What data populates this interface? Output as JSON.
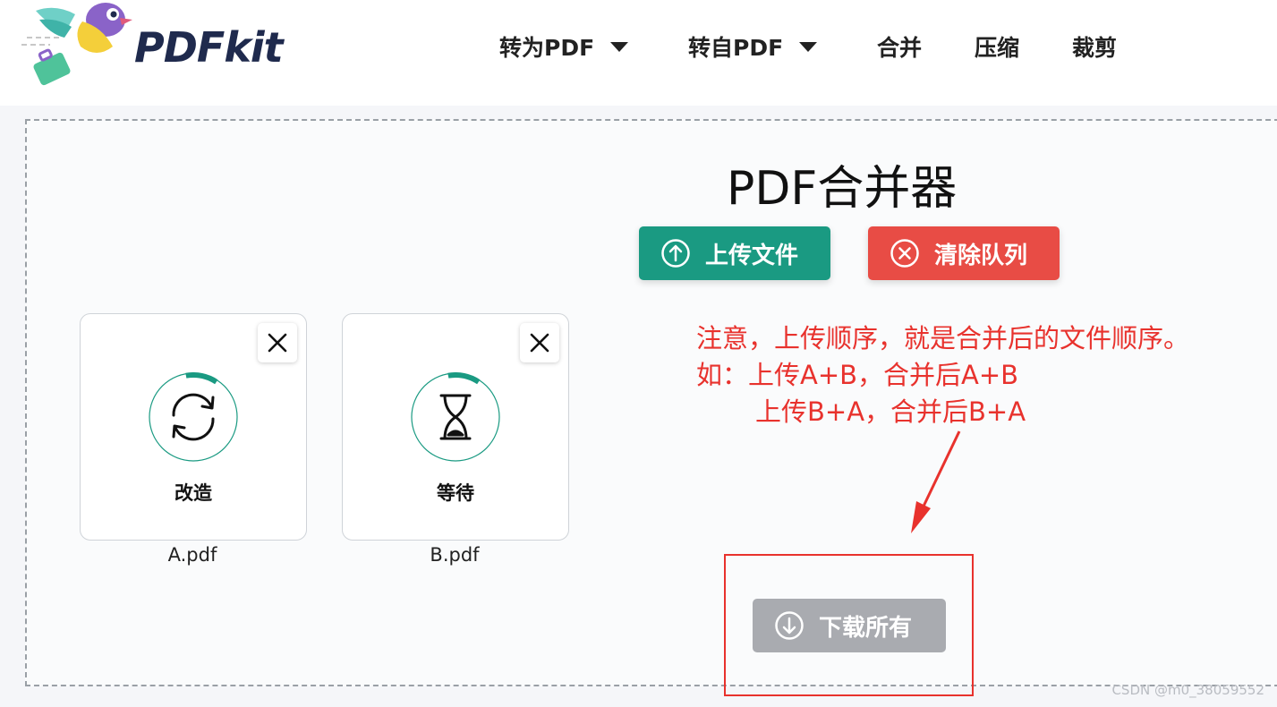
{
  "brand": {
    "name": "PDFkit"
  },
  "nav": {
    "items": [
      {
        "label": "转为PDF",
        "dropdown": true
      },
      {
        "label": "转自PDF",
        "dropdown": true
      },
      {
        "label": "合并",
        "dropdown": false
      },
      {
        "label": "压缩",
        "dropdown": false
      },
      {
        "label": "裁剪",
        "dropdown": false
      }
    ]
  },
  "main": {
    "title": "PDF合并器",
    "upload_label": "上传文件",
    "clear_label": "清除队列",
    "download_label": "下载所有",
    "files": [
      {
        "name": "A.pdf",
        "status": "改造",
        "icon": "refresh-icon",
        "progress": 0.12
      },
      {
        "name": "B.pdf",
        "status": "等待",
        "icon": "hourglass-icon",
        "progress": 0.12
      }
    ]
  },
  "annotation": {
    "line1": "注意，上传顺序，就是合并后的文件顺序。",
    "line2": "如：上传A+B，合并后A+B",
    "line3": "上传B+A，合并后B+A"
  },
  "watermark": "CSDN @m0_38059552",
  "colors": {
    "primary_green": "#1a9a82",
    "danger_red": "#e84c45",
    "disabled_gray": "#a9abb0",
    "annotation_red": "#e8322d",
    "brand_navy": "#1f2a4d"
  }
}
